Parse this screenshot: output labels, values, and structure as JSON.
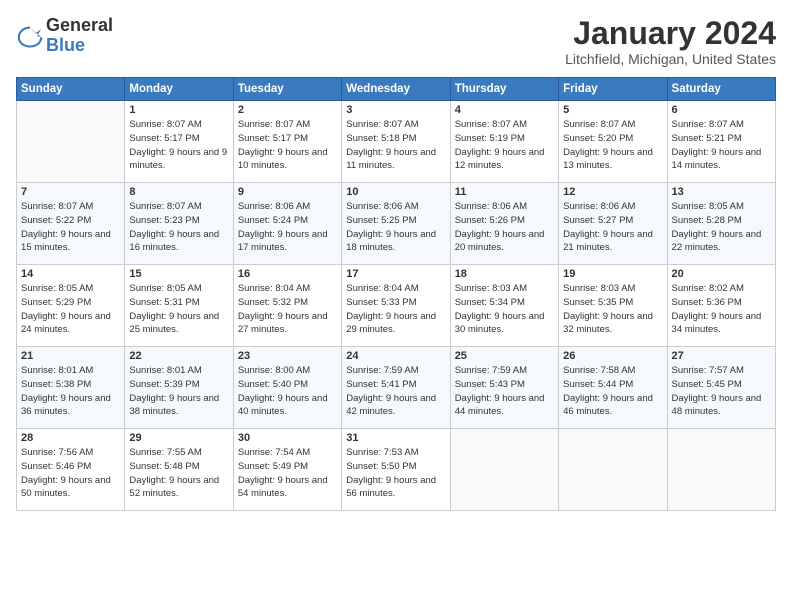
{
  "logo": {
    "general": "General",
    "blue": "Blue"
  },
  "title": "January 2024",
  "location": "Litchfield, Michigan, United States",
  "weekdays": [
    "Sunday",
    "Monday",
    "Tuesday",
    "Wednesday",
    "Thursday",
    "Friday",
    "Saturday"
  ],
  "weeks": [
    [
      {
        "day": "",
        "sunrise": "",
        "sunset": "",
        "daylight": "",
        "empty": true
      },
      {
        "day": "1",
        "sunrise": "Sunrise: 8:07 AM",
        "sunset": "Sunset: 5:17 PM",
        "daylight": "Daylight: 9 hours and 9 minutes."
      },
      {
        "day": "2",
        "sunrise": "Sunrise: 8:07 AM",
        "sunset": "Sunset: 5:17 PM",
        "daylight": "Daylight: 9 hours and 10 minutes."
      },
      {
        "day": "3",
        "sunrise": "Sunrise: 8:07 AM",
        "sunset": "Sunset: 5:18 PM",
        "daylight": "Daylight: 9 hours and 11 minutes."
      },
      {
        "day": "4",
        "sunrise": "Sunrise: 8:07 AM",
        "sunset": "Sunset: 5:19 PM",
        "daylight": "Daylight: 9 hours and 12 minutes."
      },
      {
        "day": "5",
        "sunrise": "Sunrise: 8:07 AM",
        "sunset": "Sunset: 5:20 PM",
        "daylight": "Daylight: 9 hours and 13 minutes."
      },
      {
        "day": "6",
        "sunrise": "Sunrise: 8:07 AM",
        "sunset": "Sunset: 5:21 PM",
        "daylight": "Daylight: 9 hours and 14 minutes."
      }
    ],
    [
      {
        "day": "7",
        "sunrise": "Sunrise: 8:07 AM",
        "sunset": "Sunset: 5:22 PM",
        "daylight": "Daylight: 9 hours and 15 minutes."
      },
      {
        "day": "8",
        "sunrise": "Sunrise: 8:07 AM",
        "sunset": "Sunset: 5:23 PM",
        "daylight": "Daylight: 9 hours and 16 minutes."
      },
      {
        "day": "9",
        "sunrise": "Sunrise: 8:06 AM",
        "sunset": "Sunset: 5:24 PM",
        "daylight": "Daylight: 9 hours and 17 minutes."
      },
      {
        "day": "10",
        "sunrise": "Sunrise: 8:06 AM",
        "sunset": "Sunset: 5:25 PM",
        "daylight": "Daylight: 9 hours and 18 minutes."
      },
      {
        "day": "11",
        "sunrise": "Sunrise: 8:06 AM",
        "sunset": "Sunset: 5:26 PM",
        "daylight": "Daylight: 9 hours and 20 minutes."
      },
      {
        "day": "12",
        "sunrise": "Sunrise: 8:06 AM",
        "sunset": "Sunset: 5:27 PM",
        "daylight": "Daylight: 9 hours and 21 minutes."
      },
      {
        "day": "13",
        "sunrise": "Sunrise: 8:05 AM",
        "sunset": "Sunset: 5:28 PM",
        "daylight": "Daylight: 9 hours and 22 minutes."
      }
    ],
    [
      {
        "day": "14",
        "sunrise": "Sunrise: 8:05 AM",
        "sunset": "Sunset: 5:29 PM",
        "daylight": "Daylight: 9 hours and 24 minutes."
      },
      {
        "day": "15",
        "sunrise": "Sunrise: 8:05 AM",
        "sunset": "Sunset: 5:31 PM",
        "daylight": "Daylight: 9 hours and 25 minutes."
      },
      {
        "day": "16",
        "sunrise": "Sunrise: 8:04 AM",
        "sunset": "Sunset: 5:32 PM",
        "daylight": "Daylight: 9 hours and 27 minutes."
      },
      {
        "day": "17",
        "sunrise": "Sunrise: 8:04 AM",
        "sunset": "Sunset: 5:33 PM",
        "daylight": "Daylight: 9 hours and 29 minutes."
      },
      {
        "day": "18",
        "sunrise": "Sunrise: 8:03 AM",
        "sunset": "Sunset: 5:34 PM",
        "daylight": "Daylight: 9 hours and 30 minutes."
      },
      {
        "day": "19",
        "sunrise": "Sunrise: 8:03 AM",
        "sunset": "Sunset: 5:35 PM",
        "daylight": "Daylight: 9 hours and 32 minutes."
      },
      {
        "day": "20",
        "sunrise": "Sunrise: 8:02 AM",
        "sunset": "Sunset: 5:36 PM",
        "daylight": "Daylight: 9 hours and 34 minutes."
      }
    ],
    [
      {
        "day": "21",
        "sunrise": "Sunrise: 8:01 AM",
        "sunset": "Sunset: 5:38 PM",
        "daylight": "Daylight: 9 hours and 36 minutes."
      },
      {
        "day": "22",
        "sunrise": "Sunrise: 8:01 AM",
        "sunset": "Sunset: 5:39 PM",
        "daylight": "Daylight: 9 hours and 38 minutes."
      },
      {
        "day": "23",
        "sunrise": "Sunrise: 8:00 AM",
        "sunset": "Sunset: 5:40 PM",
        "daylight": "Daylight: 9 hours and 40 minutes."
      },
      {
        "day": "24",
        "sunrise": "Sunrise: 7:59 AM",
        "sunset": "Sunset: 5:41 PM",
        "daylight": "Daylight: 9 hours and 42 minutes."
      },
      {
        "day": "25",
        "sunrise": "Sunrise: 7:59 AM",
        "sunset": "Sunset: 5:43 PM",
        "daylight": "Daylight: 9 hours and 44 minutes."
      },
      {
        "day": "26",
        "sunrise": "Sunrise: 7:58 AM",
        "sunset": "Sunset: 5:44 PM",
        "daylight": "Daylight: 9 hours and 46 minutes."
      },
      {
        "day": "27",
        "sunrise": "Sunrise: 7:57 AM",
        "sunset": "Sunset: 5:45 PM",
        "daylight": "Daylight: 9 hours and 48 minutes."
      }
    ],
    [
      {
        "day": "28",
        "sunrise": "Sunrise: 7:56 AM",
        "sunset": "Sunset: 5:46 PM",
        "daylight": "Daylight: 9 hours and 50 minutes."
      },
      {
        "day": "29",
        "sunrise": "Sunrise: 7:55 AM",
        "sunset": "Sunset: 5:48 PM",
        "daylight": "Daylight: 9 hours and 52 minutes."
      },
      {
        "day": "30",
        "sunrise": "Sunrise: 7:54 AM",
        "sunset": "Sunset: 5:49 PM",
        "daylight": "Daylight: 9 hours and 54 minutes."
      },
      {
        "day": "31",
        "sunrise": "Sunrise: 7:53 AM",
        "sunset": "Sunset: 5:50 PM",
        "daylight": "Daylight: 9 hours and 56 minutes."
      },
      {
        "day": "",
        "sunrise": "",
        "sunset": "",
        "daylight": "",
        "empty": true
      },
      {
        "day": "",
        "sunrise": "",
        "sunset": "",
        "daylight": "",
        "empty": true
      },
      {
        "day": "",
        "sunrise": "",
        "sunset": "",
        "daylight": "",
        "empty": true
      }
    ]
  ]
}
